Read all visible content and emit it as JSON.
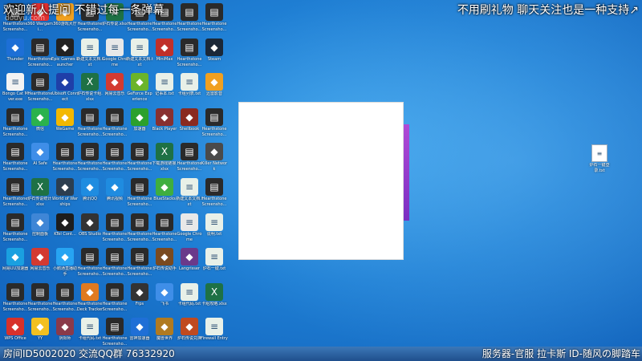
{
  "overlay": {
    "top_left": "欢迎新人提问 不错过每一条弹幕",
    "watermark": "douyu.com",
    "top_right": "不用刷礼物 聊天关注也是一种支持↗"
  },
  "desktop_icons": [
    {
      "label": "Hearthstone Screensho...",
      "icon": "hearthstone-screenshot-icon",
      "color": "#2a2a2a"
    },
    {
      "label": "Thunder",
      "icon": "thunder-icon",
      "color": "#1d6fd6"
    },
    {
      "label": "Bongo Cat Mver.exe",
      "icon": "bongo-cat-icon",
      "color": "#f3f3f3"
    },
    {
      "label": "Hearthstone Screensho...",
      "icon": "hearthstone-screenshot-icon",
      "color": "#2a2a2a"
    },
    {
      "label": "Hearthstone Screensho...",
      "icon": "hearthstone-screenshot-icon",
      "color": "#2a2a2a"
    },
    {
      "label": "Hearthstone Screensho...",
      "icon": "hearthstone-screenshot-icon",
      "color": "#2a2a2a"
    },
    {
      "label": "Hearthstone Screensho...",
      "icon": "hearthstone-screenshot-icon",
      "color": "#2a2a2a"
    },
    {
      "label": "网易UU加速器",
      "icon": "uu-booster-icon",
      "color": "#1aa0e0"
    },
    {
      "label": "Hearthstone Screensho...",
      "icon": "hearthstone-screenshot-icon",
      "color": "#2a2a2a"
    },
    {
      "label": "WPS Office",
      "icon": "wps-office-icon",
      "color": "#d7312b"
    },
    {
      "label": "360 Wargami...",
      "icon": "360-game-icon",
      "color": "#e03030"
    },
    {
      "label": "Hearthstone Screensho...",
      "icon": "hearthstone-screenshot-icon",
      "color": "#2a2a2a"
    },
    {
      "label": "Hearthstone Screensho...",
      "icon": "hearthstone-screenshot-icon",
      "color": "#2a2a2a"
    },
    {
      "label": "微信",
      "icon": "wechat-icon",
      "color": "#2bb24c"
    },
    {
      "label": "AI Safe",
      "icon": "ai-safe-icon",
      "color": "#3f8ee8"
    },
    {
      "label": "炉石传说统计.xlsx",
      "icon": "excel-file-icon",
      "color": "#1e7145"
    },
    {
      "label": "控制面板",
      "icon": "control-panel-icon",
      "color": "#3f86d6"
    },
    {
      "label": "网易云音乐",
      "icon": "netease-music-icon",
      "color": "#d33a31"
    },
    {
      "label": "Hearthstone Screensho...",
      "icon": "hearthstone-screenshot-icon",
      "color": "#2a2a2a"
    },
    {
      "label": "YY",
      "icon": "yy-icon",
      "color": "#f3c021"
    },
    {
      "label": "360游戏大厅",
      "icon": "360-hall-icon",
      "color": "#f0a020"
    },
    {
      "label": "Epic Games Launcher",
      "icon": "epic-games-icon",
      "color": "#222222"
    },
    {
      "label": "Ubisoft Connect",
      "icon": "ubisoft-icon",
      "color": "#1f3fa8"
    },
    {
      "label": "WeGame",
      "icon": "wegame-icon",
      "color": "#f3b800"
    },
    {
      "label": "Hearthstone Screensho...",
      "icon": "hearthstone-screenshot-icon",
      "color": "#2a2a2a"
    },
    {
      "label": "World of Warships",
      "icon": "warships-icon",
      "color": "#2c3e50"
    },
    {
      "label": "KTel Cont...",
      "icon": "ktel-icon",
      "color": "#1d1d1d"
    },
    {
      "label": "小鹅通直播助手",
      "icon": "xiaoe-icon",
      "color": "#27a4f2"
    },
    {
      "label": "Hearthstone Screensho...",
      "icon": "hearthstone-screenshot-icon",
      "color": "#2a2a2a"
    },
    {
      "label": "阴阳师",
      "icon": "onmyoji-icon",
      "color": "#8a3a4a"
    },
    {
      "label": "Hearthstone Screensho...",
      "icon": "hearthstone-screenshot-icon",
      "color": "#2a2a2a"
    },
    {
      "label": "新建文本文档.txt",
      "icon": "text-file-icon",
      "color": "#e8f0e8"
    },
    {
      "label": "炉石传说卡组.xlsx",
      "icon": "excel-file-icon",
      "color": "#1e7145"
    },
    {
      "label": "Hearthstone Screensho...",
      "icon": "hearthstone-screenshot-icon",
      "color": "#2a2a2a"
    },
    {
      "label": "Hearthstone Screensho...",
      "icon": "hearthstone-screenshot-icon",
      "color": "#2a2a2a"
    },
    {
      "label": "腾讯QQ",
      "icon": "qq-icon",
      "color": "#1f8ce0"
    },
    {
      "label": "OBS Studio",
      "icon": "obs-icon",
      "color": "#333333"
    },
    {
      "label": "Hearthstone Screensho...",
      "icon": "hearthstone-screenshot-icon",
      "color": "#2a2a2a"
    },
    {
      "label": "Hearthstone Deck Tracker",
      "icon": "deck-tracker-icon",
      "color": "#e07a20"
    },
    {
      "label": "卡组代码.txt",
      "icon": "text-file-icon",
      "color": "#e8f0e8"
    },
    {
      "label": "炉石传说.xlsx",
      "icon": "excel-file-icon",
      "color": "#1e7145"
    },
    {
      "label": "Google Chrome",
      "icon": "chrome-icon",
      "color": "#e8e8e8"
    },
    {
      "label": "网易云音乐",
      "icon": "netease-music-icon",
      "color": "#d33a31"
    },
    {
      "label": "Hearthstone Screensho...",
      "icon": "hearthstone-screenshot-icon",
      "color": "#2a2a2a"
    },
    {
      "label": "Hearthstone Screensho...",
      "icon": "hearthstone-screenshot-icon",
      "color": "#2a2a2a"
    },
    {
      "label": "腾讯视频",
      "icon": "tencent-video-icon",
      "color": "#1f8ce0"
    },
    {
      "label": "Hearthstone Screensho...",
      "icon": "hearthstone-screenshot-icon",
      "color": "#2a2a2a"
    },
    {
      "label": "Hearthstone Screensho...",
      "icon": "hearthstone-screenshot-icon",
      "color": "#2a2a2a"
    },
    {
      "label": "Hearthstone Screensho...",
      "icon": "hearthstone-screenshot-icon",
      "color": "#2a2a2a"
    },
    {
      "label": "Hearthstone Screensho...",
      "icon": "hearthstone-screenshot-icon",
      "color": "#2a2a2a"
    },
    {
      "label": "Hearthstone Screensho...",
      "icon": "hearthstone-screenshot-icon",
      "color": "#2a2a2a"
    },
    {
      "label": "新建文本文档.txt",
      "icon": "text-file-icon",
      "color": "#e8f0e8"
    },
    {
      "label": "GeForce Experience",
      "icon": "geforce-icon",
      "color": "#6bb42a"
    },
    {
      "label": "加速器",
      "icon": "booster-icon",
      "color": "#2ca02c"
    },
    {
      "label": "Hearthstone Screensho...",
      "icon": "hearthstone-screenshot-icon",
      "color": "#2a2a2a"
    },
    {
      "label": "Hearthstone Screensho...",
      "icon": "hearthstone-screenshot-icon",
      "color": "#2a2a2a"
    },
    {
      "label": "Hearthstone Screensho...",
      "icon": "hearthstone-screenshot-icon",
      "color": "#2a2a2a"
    },
    {
      "label": "Hearthstone Screensho...",
      "icon": "hearthstone-screenshot-icon",
      "color": "#2a2a2a"
    },
    {
      "label": "Frps",
      "icon": "frps-icon",
      "color": "#333333"
    },
    {
      "label": "雷神加速器",
      "icon": "leishen-icon",
      "color": "#1f6fd6"
    },
    {
      "label": "Hearthstone Screensho...",
      "icon": "hearthstone-screenshot-icon",
      "color": "#2a2a2a"
    },
    {
      "label": "MiniMax",
      "icon": "minimax-icon",
      "color": "#c0302a"
    },
    {
      "label": "记事本.txt",
      "icon": "text-file-icon",
      "color": "#e8f0e8"
    },
    {
      "label": "Black Player",
      "icon": "black-player-icon",
      "color": "#883030"
    },
    {
      "label": "下载游戏链接.xlsx",
      "icon": "excel-file-icon",
      "color": "#1e7145"
    },
    {
      "label": "BlueStacks",
      "icon": "bluestacks-icon",
      "color": "#3fae3f"
    },
    {
      "label": "Hearthstone Screensho...",
      "icon": "hearthstone-screenshot-icon",
      "color": "#2a2a2a"
    },
    {
      "label": "炉石传说助手",
      "icon": "hs-helper-icon",
      "color": "#7a4a20"
    },
    {
      "label": "飞书",
      "icon": "feishu-icon",
      "color": "#3f8ee8"
    },
    {
      "label": "魔兽世界",
      "icon": "wow-icon",
      "color": "#b07a20"
    },
    {
      "label": "Hearthstone Screensho...",
      "icon": "hearthstone-screenshot-icon",
      "color": "#2a2a2a"
    },
    {
      "label": "Hearthstone Screensho...",
      "icon": "hearthstone-screenshot-icon",
      "color": "#2a2a2a"
    },
    {
      "label": "卡组列表.txt",
      "icon": "text-file-icon",
      "color": "#e8f0e8"
    },
    {
      "label": "Shellbook",
      "icon": "shellbook-icon",
      "color": "#8a2a20"
    },
    {
      "label": "Hearthstone Screensho...",
      "icon": "hearthstone-screenshot-icon",
      "color": "#2a2a2a"
    },
    {
      "label": "新建文本文档.txt",
      "icon": "text-file-icon",
      "color": "#e8f0e8"
    },
    {
      "label": "Google Chrome",
      "icon": "chrome-icon",
      "color": "#e8e8e8"
    },
    {
      "label": "Langrisser",
      "icon": "langrisser-icon",
      "color": "#6a3a8a"
    },
    {
      "label": "卡组代码.txt",
      "icon": "text-file-icon",
      "color": "#e8f0e8"
    },
    {
      "label": "炉石传说兑换",
      "icon": "hs-exchange-icon",
      "color": "#c04a20"
    },
    {
      "label": "Hearthstone Screensho...",
      "icon": "hearthstone-screenshot-icon",
      "color": "#2a2a2a"
    },
    {
      "label": "Steam",
      "icon": "steam-icon",
      "color": "#1b2838"
    },
    {
      "label": "迅雷影音",
      "icon": "xunlei-video-icon",
      "color": "#f0a020"
    },
    {
      "label": "Hearthstone Screensho...",
      "icon": "hearthstone-screenshot-icon",
      "color": "#2a2a2a"
    },
    {
      "label": "Killer Network",
      "icon": "killer-network-icon",
      "color": "#4a4a4a"
    },
    {
      "label": "Hearthstone Screensho...",
      "icon": "hearthstone-screenshot-icon",
      "color": "#2a2a2a"
    },
    {
      "label": "说明.txt",
      "icon": "text-file-icon",
      "color": "#e8f0e8"
    },
    {
      "label": "炉石一键.txt",
      "icon": "text-file-icon",
      "color": "#e8f0e8"
    },
    {
      "label": "卡组攻略.xlsx",
      "icon": "excel-file-icon",
      "color": "#1e7145"
    },
    {
      "label": "Firewall Entry",
      "icon": "firewall-file-icon",
      "color": "#e8f0e8"
    }
  ],
  "right_file": {
    "label": "炉石一键登录.txt",
    "icon": "text-file-icon"
  },
  "taskbar": {
    "left": "房间ID5002020 交流QQ群 76332920",
    "right": "服务器-官服 拉卡斯 ID-随风の脚踏车"
  },
  "colors": {
    "popup_accent": "#9a3fd0",
    "taskbar": "#2a5f9e"
  }
}
